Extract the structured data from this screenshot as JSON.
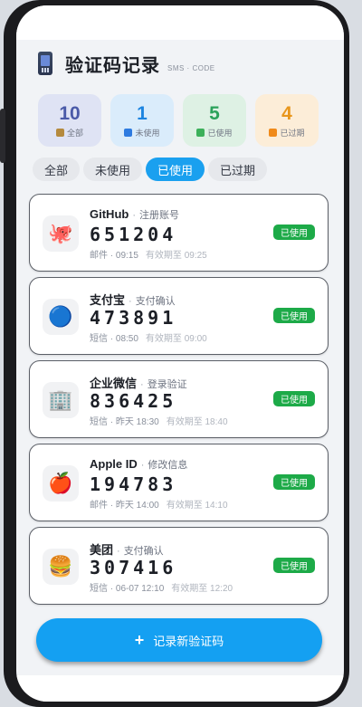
{
  "header": {
    "title": "验证码记录",
    "subtitle": "SMS · CODE",
    "icon": "phone-icon"
  },
  "stats": [
    {
      "num": "10",
      "label": "全部",
      "color": "#4a5aa8",
      "swatch": "#b58a3e"
    },
    {
      "num": "1",
      "label": "未使用",
      "color": "#1c84e0",
      "swatch": "#2e7be0"
    },
    {
      "num": "5",
      "label": "已使用",
      "color": "#2ba25a",
      "swatch": "#3cb05a"
    },
    {
      "num": "4",
      "label": "已过期",
      "color": "#e8961c",
      "swatch": "#f08a1a"
    }
  ],
  "tabs": [
    {
      "label": "全部",
      "active": false
    },
    {
      "label": "未使用",
      "active": false
    },
    {
      "label": "已使用",
      "active": true
    },
    {
      "label": "已过期",
      "active": false
    }
  ],
  "records": [
    {
      "name": "GitHub",
      "purpose": "注册账号",
      "code": "651204",
      "source": "邮件 · 09:15",
      "expiry": "有效期至 09:25",
      "status": "已使用",
      "icon": "octopus-icon",
      "emoji": "🐙"
    },
    {
      "name": "支付宝",
      "purpose": "支付确认",
      "code": "473891",
      "source": "短信 · 08:50",
      "expiry": "有效期至 09:00",
      "status": "已使用",
      "icon": "blue-circle-icon",
      "emoji": "🔵"
    },
    {
      "name": "企业微信",
      "purpose": "登录验证",
      "code": "836425",
      "source": "短信 · 昨天 18:30",
      "expiry": "有效期至 18:40",
      "status": "已使用",
      "icon": "office-building-icon",
      "emoji": "🏢"
    },
    {
      "name": "Apple ID",
      "purpose": "修改信息",
      "code": "194783",
      "source": "邮件 · 昨天 14:00",
      "expiry": "有效期至 14:10",
      "status": "已使用",
      "icon": "apple-icon",
      "emoji": "🍎"
    },
    {
      "name": "美团",
      "purpose": "支付确认",
      "code": "307416",
      "source": "短信 · 06-07 12:10",
      "expiry": "有效期至 12:20",
      "status": "已使用",
      "icon": "burger-icon",
      "emoji": "🍔"
    }
  ],
  "add_button": {
    "label": "记录新验证码",
    "icon": "plus-icon"
  },
  "colors": {
    "accent": "#1aa0ef",
    "used_badge": "#1daa48"
  }
}
